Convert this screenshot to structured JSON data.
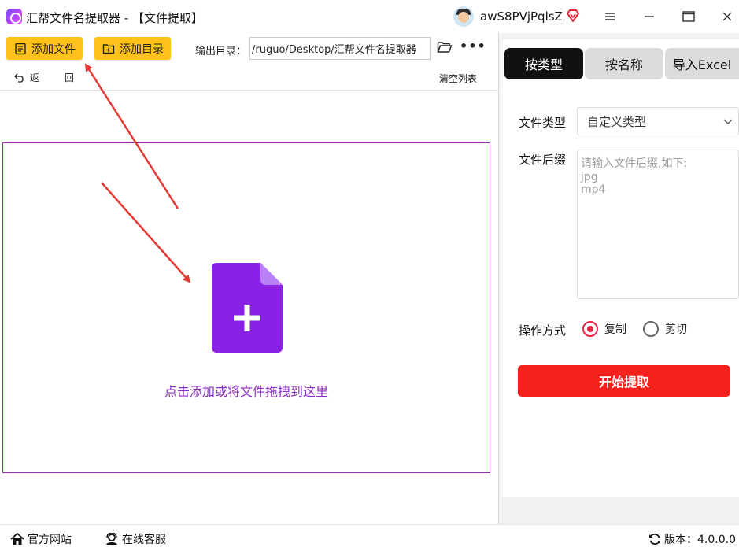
{
  "window": {
    "title": "汇帮文件名提取器 - 【文件提取】",
    "username": "awS8PVjPqlsZ"
  },
  "toolbar": {
    "add_file": "添加文件",
    "add_dir": "添加目录",
    "output_label": "输出目录：",
    "output_path": "/ruguo/Desktop/汇帮文件名提取器",
    "more": "•••",
    "back": "返 回",
    "clear_list": "清空列表"
  },
  "dropzone": {
    "hint": "点击添加或将文件拖拽到这里"
  },
  "panel": {
    "tabs": [
      "按类型",
      "按名称",
      "导入Excel"
    ],
    "active_tab": 0,
    "file_type_label": "文件类型",
    "file_type_value": "自定义类型",
    "suffix_label": "文件后缀",
    "suffix_placeholder": "请输入文件后缀,如下:\njpg\nmp4",
    "operation_label": "操作方式",
    "options": [
      "复制",
      "剪切"
    ],
    "selected_option": 0,
    "start_button": "开始提取"
  },
  "statusbar": {
    "website": "官方网站",
    "support": "在线客服",
    "version": "版本：4.0.0.0"
  },
  "colors": {
    "accent_yellow": "#ffc21a",
    "accent_purple": "#8a2fc2",
    "start_red": "#f5211c",
    "arrow_red": "#e53935"
  }
}
